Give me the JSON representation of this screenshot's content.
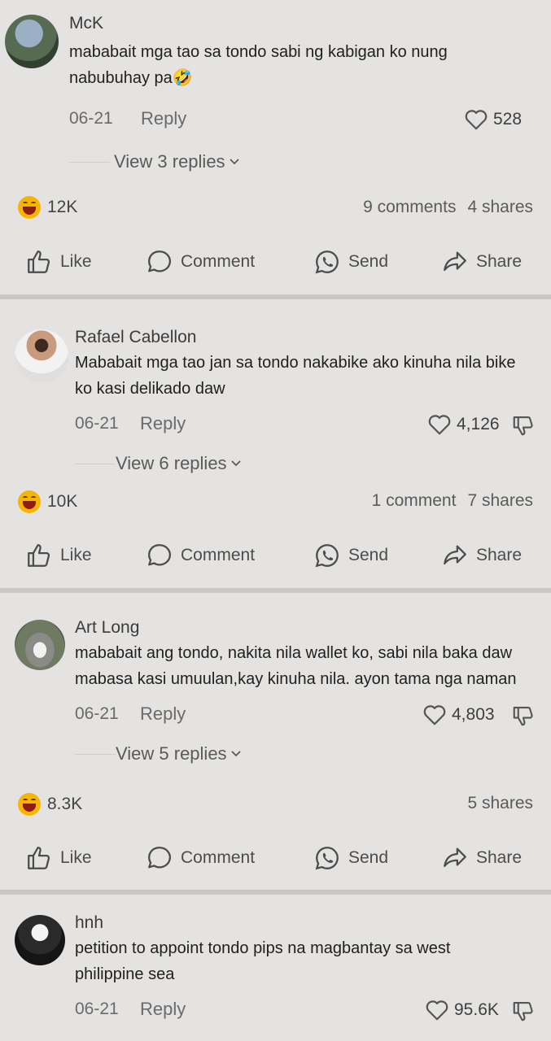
{
  "comments": [
    {
      "username": "McK",
      "text": "mababait mga tao sa tondo sabi ng kabigan ko nung nabubuhay pa🤣",
      "text_lines": [
        "mababait mga tao sa tondo sabi ng kabigan ko nung",
        "nabubuhay pa🤣"
      ],
      "date": "06-21",
      "reply_label": "Reply",
      "likes": "528",
      "view_replies": "View 3 replies",
      "reaction_count": "12K",
      "comments_count": "9 comments",
      "shares_count": "4 shares"
    },
    {
      "username": "Rafael Cabellon",
      "text_lines": [
        "Mababait mga tao jan sa tondo nakabike ako kinuha nila bike",
        "ko kasi delikado daw"
      ],
      "date": "06-21",
      "reply_label": "Reply",
      "likes": "4,126",
      "view_replies": "View 6 replies",
      "reaction_count": "10K",
      "comments_count": "1 comment",
      "shares_count": "7 shares"
    },
    {
      "username": "Art Long",
      "text_lines": [
        "mababait ang tondo, nakita nila wallet ko, sabi nila baka daw",
        "mabasa kasi umuulan,kay kinuha nila. ayon tama nga naman"
      ],
      "date": "06-21",
      "reply_label": "Reply",
      "likes": "4,803",
      "view_replies": "View 5 replies",
      "reaction_count": "8.3K",
      "shares_count": "5 shares"
    },
    {
      "username": "hnh",
      "text_lines": [
        "petition to appoint tondo pips na magbantay sa west",
        "philippine sea"
      ],
      "date": "06-21",
      "reply_label": "Reply",
      "likes": "95.6K"
    }
  ],
  "actions": {
    "like": "Like",
    "comment": "Comment",
    "send": "Send",
    "share": "Share"
  },
  "colors": {
    "background": "#e4e3e1",
    "divider": "#c9c8c6",
    "reaction_emoji": "#f7b500"
  }
}
